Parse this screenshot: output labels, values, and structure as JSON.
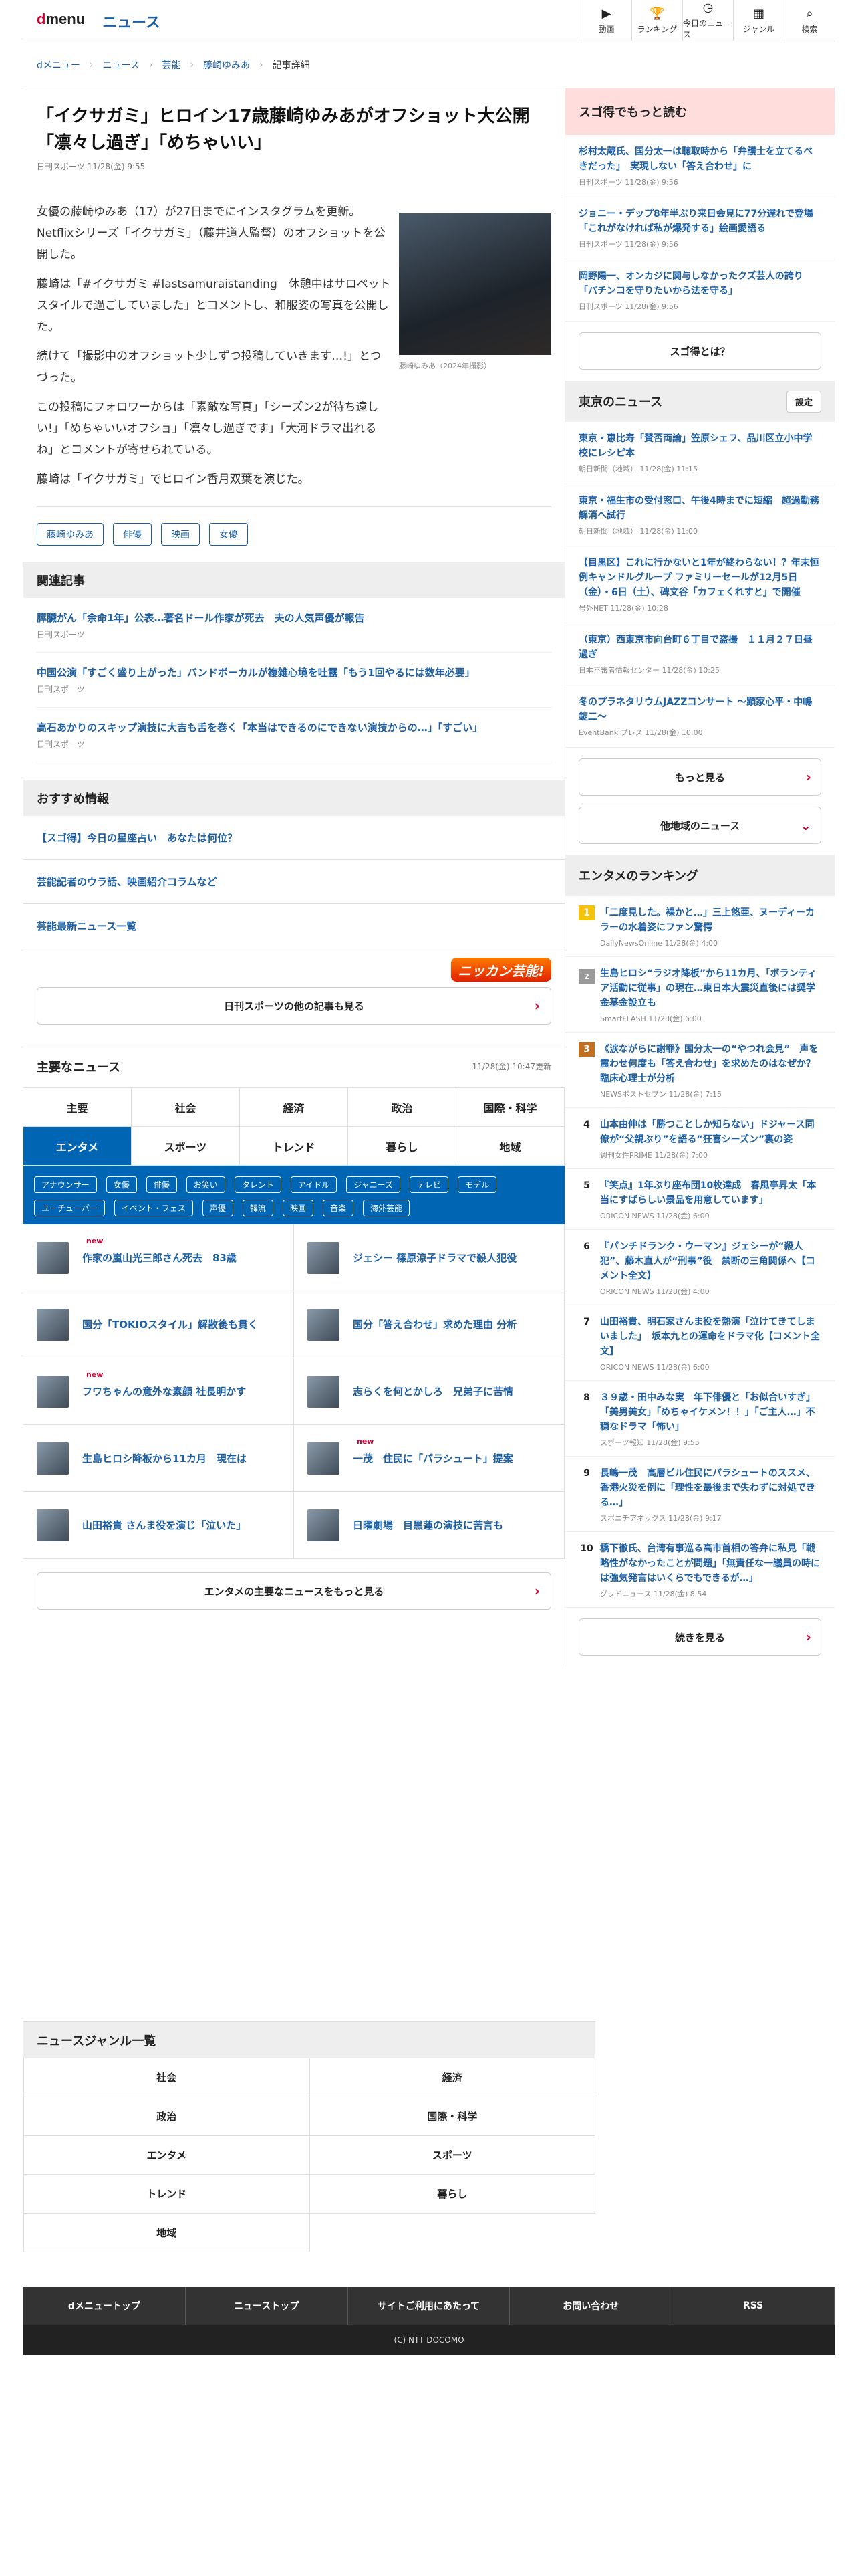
{
  "header": {
    "logo": "dmenu",
    "section": "ニュース",
    "nav": [
      {
        "icon": "video-icon",
        "glyph": "▶",
        "label": "動画"
      },
      {
        "icon": "trophy-icon",
        "glyph": "🏆",
        "label": "ランキング"
      },
      {
        "icon": "clock-icon",
        "glyph": "◷",
        "label": "今日のニュース"
      },
      {
        "icon": "grid-icon",
        "glyph": "▦",
        "label": "ジャンル"
      },
      {
        "icon": "search-icon",
        "glyph": "⌕",
        "label": "検索"
      }
    ]
  },
  "breadcrumb": [
    "dメニュー",
    "ニュース",
    "芸能",
    "藤崎ゆみあ",
    "記事詳細"
  ],
  "article": {
    "title": "「イクサガミ」ヒロイン17歳藤崎ゆみあがオフショット大公開「凛々し過ぎ」「めちゃいい」",
    "source": "日刊スポーツ 11/28(金) 9:55",
    "paragraphs": [
      "女優の藤崎ゆみあ（17）が27日までにインスタグラムを更新。Netflixシリーズ「イクサガミ」（藤井道人監督）のオフショットを公開した。",
      "藤崎は「#イクサガミ #lastsamuraistanding　休憩中はサロペットスタイルで過ごしていました」とコメントし、和服姿の写真を公開した。",
      "続けて「撮影中のオフショット少しずつ投稿していきます…!」とつづった。",
      "この投稿にフォロワーからは「素敵な写真」「シーズン2が待ち遠しい!」「めちゃいいオフショ」「凛々し過ぎです」「大河ドラマ出れるね」とコメントが寄せられている。",
      "藤崎は「イクサガミ」でヒロイン香月双葉を演じた。"
    ],
    "photo_caption": "藤崎ゆみあ（2024年撮影）",
    "tags": [
      "藤崎ゆみあ",
      "俳優",
      "映画",
      "女優"
    ]
  },
  "related": {
    "heading": "関連記事",
    "items": [
      {
        "title": "膵臓がん「余命1年」公表…著名ドール作家が死去　夫の人気声優が報告",
        "source": "日刊スポーツ"
      },
      {
        "title": "中国公演「すごく盛り上がった」バンドボーカルが複雑心境を吐露「もう1回やるには数年必要」",
        "source": "日刊スポーツ"
      },
      {
        "title": "高石あかりのスキップ演技に大吉も舌を巻く「本当はできるのにできない演技からの…」「すごい」",
        "source": "日刊スポーツ"
      }
    ]
  },
  "recommended": {
    "heading": "おすすめ情報",
    "items": [
      "【スゴ得】今日の星座占い　あなたは何位？",
      "芸能記者のウラ話、映画紹介コラムなど",
      "芸能最新ニュース一覧"
    ]
  },
  "brand_badge": "ニッカン芸能!",
  "more_from_source": "日刊スポーツの他の記事も見る",
  "main_news": {
    "heading": "主要なニュース",
    "date": "11/28(金) 10:47更新",
    "categories": [
      "主要",
      "社会",
      "経済",
      "政治",
      "国際・科学",
      "エンタメ",
      "スポーツ",
      "トレンド",
      "暮らし",
      "地域"
    ],
    "active_category": "エンタメ",
    "subtags": [
      "アナウンサー",
      "女優",
      "俳優",
      "お笑い",
      "タレント",
      "アイドル",
      "ジャニーズ",
      "テレビ",
      "モデル",
      "ユーチューバー",
      "イベント・フェス",
      "声優",
      "韓流",
      "映画",
      "音楽",
      "海外芸能"
    ],
    "items": [
      {
        "title": "作家の嵐山光三郎さん死去　83歳",
        "new": "new"
      },
      {
        "title": "ジェシー 篠原涼子ドラマで殺人犯役",
        "new": ""
      },
      {
        "title": "国分「TOKIOスタイル」解散後も貫く",
        "new": ""
      },
      {
        "title": "国分「答え合わせ」求めた理由 分析",
        "new": ""
      },
      {
        "title": "フワちゃんの意外な素顔 社長明かす",
        "new": "new"
      },
      {
        "title": "志らくを何とかしろ　兄弟子に苦情",
        "new": ""
      },
      {
        "title": "生島ヒロシ降板から11カ月　現在は",
        "new": ""
      },
      {
        "title": "一茂　住民に「パラシュート」提案",
        "new": "new"
      },
      {
        "title": "山田裕貴 さんま役を演じ「泣いた」",
        "new": ""
      },
      {
        "title": "日曜劇場　目黒蓮の演技に苦言も",
        "new": ""
      }
    ],
    "more": "エンタメの主要なニュースをもっと見る"
  },
  "side": {
    "sugotoku_heading": "スゴ得でもっと読む",
    "sugotoku_items": [
      {
        "title": "杉村太蔵氏、国分太一は聴取時から「弁護士を立てるべきだった」　実現しない「答え合わせ」に",
        "source": "日刊スポーツ 11/28(金) 9:56"
      },
      {
        "title": "ジョニー・デップ8年半ぶり来日会見に77分遅れで登場「これがなければ私が爆発する」絵画愛語る",
        "source": "日刊スポーツ 11/28(金) 9:56"
      },
      {
        "title": "岡野陽一、オンカジに関与しなかったクズ芸人の誇り「パチンコを守りたいから法を守る」",
        "source": "日刊スポーツ 11/28(金) 9:56"
      }
    ],
    "sugotoku_btn": "スゴ得とは？",
    "tokyo_heading": "東京のニュース",
    "settings": "設定",
    "tokyo_items": [
      {
        "title": "東京・恵比寿「賛否両論」笠原シェフ、品川区立小中学校にレシピ本",
        "source": "朝日新聞（地域） 11/28(金) 11:15"
      },
      {
        "title": "東京・福生市の受付窓口、午後4時までに短縮　超過勤務解消へ試行",
        "source": "朝日新聞（地域） 11/28(金) 11:00"
      },
      {
        "title": "【目黒区】これに行かないと1年が終わらない！？年末恒例キャンドルグループ ファミリーセールが12月5日（金）・6日（土）、碑文谷「カフェくれすと」で開催",
        "source": "号外NET 11/28(金) 10:28"
      },
      {
        "title": "（東京）西東京市向台町６丁目で盗撮　１１月２７日昼過ぎ",
        "source": "日本不審者情報センター 11/28(金) 10:25"
      },
      {
        "title": "冬のプラネタリウムJAZZコンサート 〜顕家心平・中嶋錠二〜",
        "source": "EventBank プレス 11/28(金) 10:00"
      }
    ],
    "tokyo_more": "もっと見る",
    "tokyo_other": "他地域のニュース",
    "ranking_heading": "エンタメのランキング",
    "ranking": [
      {
        "rank": "1",
        "title": "「二度見した。裸かと…」三上悠亜、ヌーディーカラーの水着姿にファン驚愕",
        "source": "DailyNewsOnline 11/28(金) 4:00"
      },
      {
        "rank": "2",
        "title": "生島ヒロシ“ラジオ降板”から11カ月、「ボランティア活動に従事」の現在…東日本大震災直後には奨学金基金設立も",
        "source": "SmartFLASH 11/28(金) 6:00"
      },
      {
        "rank": "3",
        "title": "《涙ながらに謝罪》国分太一の“やつれ会見”　声を震わせ何度も「答え合わせ」を求めたのはなぜか？臨床心理士が分析",
        "source": "NEWSポストセブン 11/28(金) 7:15"
      },
      {
        "rank": "4",
        "title": "山本由伸は「勝つことしか知らない」ドジャース同僚が“父親ぶり”を語る“狂喜シーズン”裏の姿",
        "source": "週刊女性PRIME 11/28(金) 7:00"
      },
      {
        "rank": "5",
        "title": "『笑点』1年ぶり座布団10枚達成　春風亭昇太「本当にすばらしい景品を用意しています」",
        "source": "ORICON NEWS 11/28(金) 6:00"
      },
      {
        "rank": "6",
        "title": "『パンチドランク・ウーマン』ジェシーが“殺人犯”、藤木直人が“刑事”役　禁断の三角関係へ【コメント全文】",
        "source": "ORICON NEWS 11/28(金) 4:00"
      },
      {
        "rank": "7",
        "title": "山田裕貴、明石家さんま役を熱演「泣けてきてしまいました」　坂本九との運命をドラマ化【コメント全文】",
        "source": "ORICON NEWS 11/28(金) 6:00"
      },
      {
        "rank": "8",
        "title": "３９歳・田中みな実　年下俳優と「お似合いすぎ」「美男美女」「めちゃイケメン！！」「ご主人…」不穏なドラマ「怖い」",
        "source": "スポーツ報知 11/28(金) 9:55"
      },
      {
        "rank": "9",
        "title": "長嶋一茂　高層ビル住民にパラシュートのススメ、香港火災を例に「理性を最後まで失わずに対処できる…」",
        "source": "スポニチアネックス 11/28(金) 9:17"
      },
      {
        "rank": "10",
        "title": "橋下徹氏、台湾有事巡る高市首相の答弁に私見「戦略性がなかったことが問題」「無責任な一議員の時には強気発言はいくらでもできるが…」",
        "source": "グッドニュース 11/28(金) 8:54"
      }
    ],
    "ranking_more": "続きを見る"
  },
  "genre": {
    "heading": "ニュースジャンル一覧",
    "items": [
      "社会",
      "経済",
      "政治",
      "国際・科学",
      "エンタメ",
      "スポーツ",
      "トレンド",
      "暮らし",
      "地域"
    ]
  },
  "footer": {
    "links": [
      "dメニュートップ",
      "ニューストップ",
      "サイトご利用にあたって",
      "お問い合わせ",
      "RSS"
    ],
    "copyright": "(C) NTT DOCOMO"
  },
  "colors": {
    "brand": "#cc0033",
    "link": "#1d5fa3",
    "active": "#0066b3"
  }
}
